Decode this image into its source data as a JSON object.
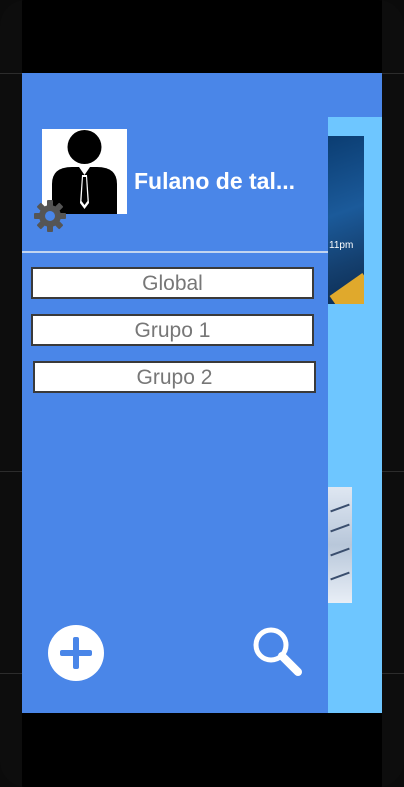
{
  "drawer": {
    "user_name": "Fulano de tal...",
    "groups": [
      {
        "label": "Global"
      },
      {
        "label": "Grupo 1"
      },
      {
        "label": "Grupo 2"
      }
    ]
  },
  "background": {
    "thumb_caption": "11pm"
  },
  "icons": {
    "avatar": "person-with-tie-icon",
    "settings": "gear-icon",
    "add": "plus-icon",
    "search": "search-icon"
  },
  "colors": {
    "drawer_bg": "#4a86e8",
    "content_bg": "#6ec6ff",
    "button_border": "#3a3a3a",
    "label_text": "#777777"
  }
}
